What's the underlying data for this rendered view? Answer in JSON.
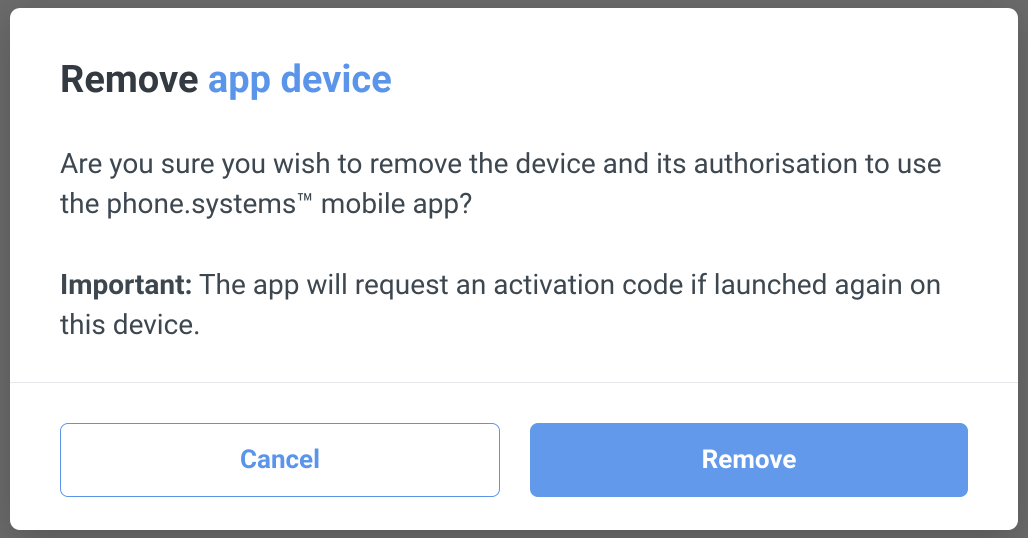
{
  "dialog": {
    "title_prefix": "Remove ",
    "title_accent": "app device",
    "body_text": "Are you sure you wish to remove the device and its authorisation to use the phone.systems™ mobile app?",
    "important_label": "Important:",
    "important_text": " The app will request an activation code if launched again on this device.",
    "buttons": {
      "cancel": "Cancel",
      "remove": "Remove"
    }
  }
}
